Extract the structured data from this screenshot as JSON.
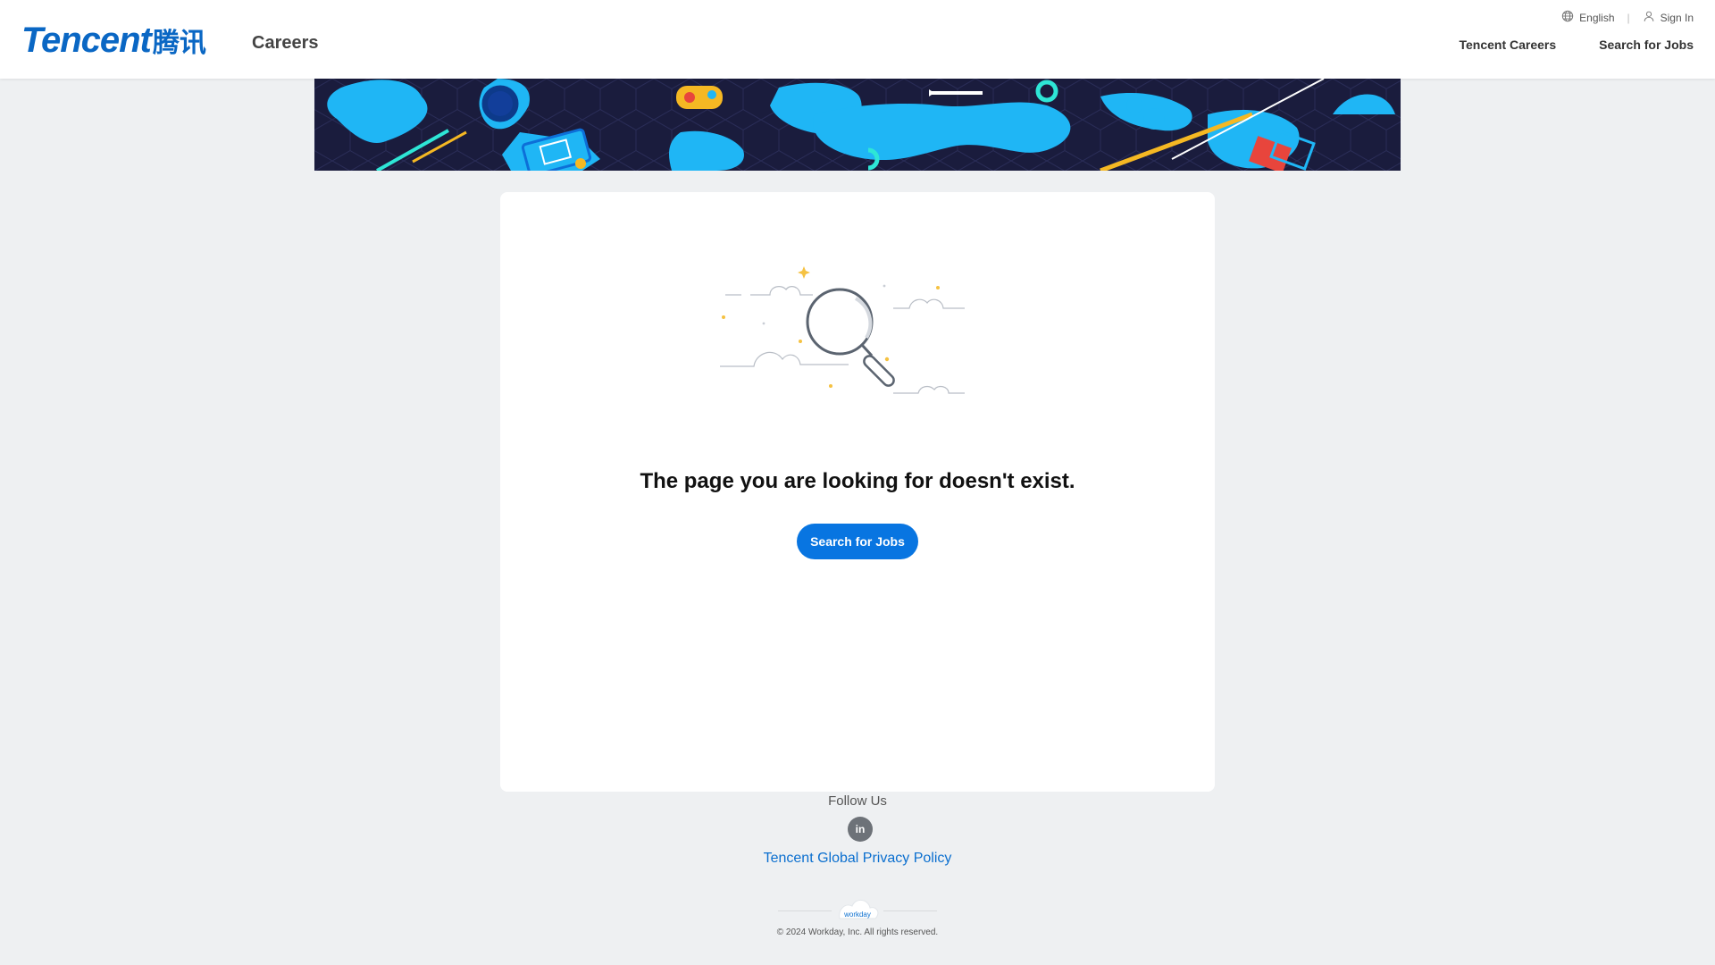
{
  "header": {
    "logo_text": "Tencent",
    "logo_cn": "腾讯",
    "careers_label": "Careers",
    "language": "English",
    "sign_in": "Sign In",
    "nav": [
      "Tencent Careers",
      "Search for Jobs"
    ]
  },
  "main": {
    "message": "The page you are looking for doesn't exist.",
    "button": "Search for Jobs"
  },
  "footer": {
    "follow_us": "Follow Us",
    "linkedin_icon": "in",
    "privacy": "Tencent Global Privacy Policy",
    "workday_logo_text": "workday",
    "copyright": "© 2024 Workday, Inc. All rights reserved."
  },
  "colors": {
    "brand_blue": "#0a67c4",
    "button_blue": "#0875e1",
    "background": "#eef0f2",
    "banner_dark": "#1a1c3d",
    "banner_cyan": "#1fb6f5"
  },
  "icons": [
    "globe-icon",
    "user-icon",
    "magnifier-illustration",
    "linkedin-icon"
  ]
}
